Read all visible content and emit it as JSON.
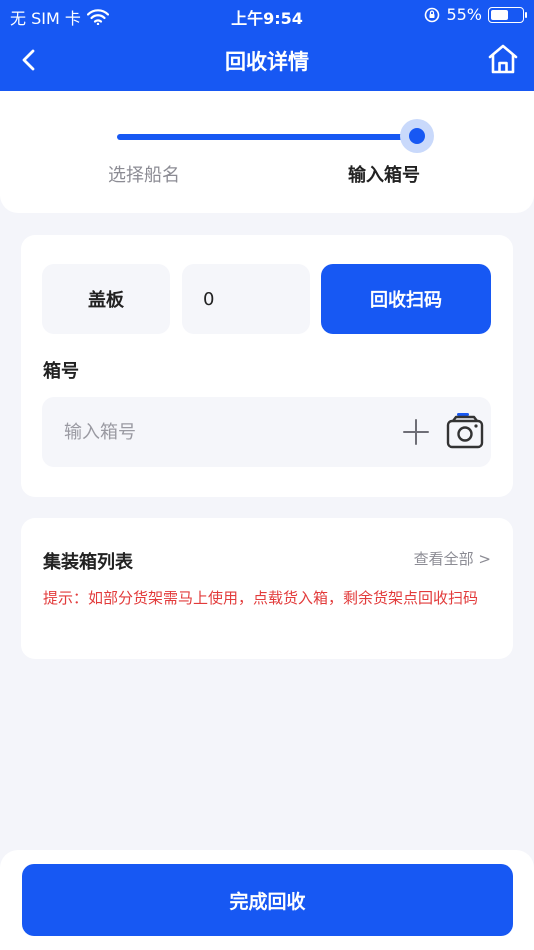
{
  "status_bar": {
    "carrier": "无 SIM 卡",
    "time": "上午9:54",
    "battery_text": "55%",
    "battery_level": 0.55
  },
  "nav": {
    "title": "回收详情",
    "back_icon": "chevron-left-icon",
    "home_icon": "home-icon"
  },
  "steps": {
    "items": [
      {
        "label": "选择船名",
        "active": false
      },
      {
        "label": "输入箱号",
        "active": true
      }
    ],
    "progress": 1.0
  },
  "form": {
    "cover_label": "盖板",
    "cover_count": "0",
    "scan_label": "回收扫码",
    "box_label": "箱号",
    "box_input": {
      "value": "",
      "placeholder": "输入箱号"
    },
    "add_icon": "plus-icon",
    "camera_icon": "camera-icon"
  },
  "container_list": {
    "title": "集装箱列表",
    "view_all": "查看全部 >",
    "hint": "提示：如部分货架需马上使用，点载货入箱，剩余货架点回收扫码"
  },
  "footer": {
    "finish_label": "完成回收"
  },
  "colors": {
    "primary": "#1758f3",
    "hint": "#e23b3b",
    "background": "#f4f5fa"
  }
}
